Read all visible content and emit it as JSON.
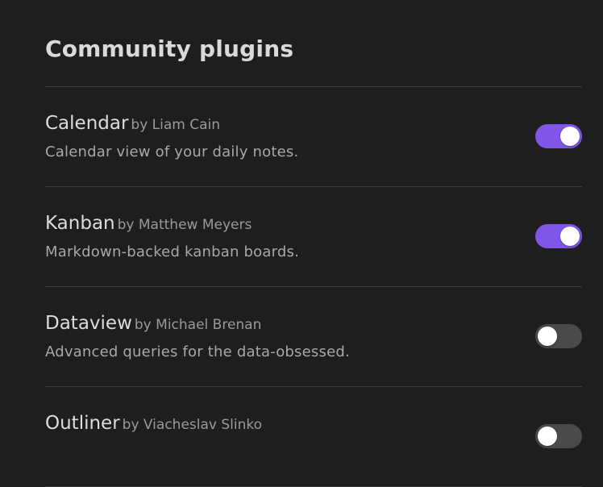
{
  "header": {
    "title": "Community plugins"
  },
  "colors": {
    "background": "#1e1e1e",
    "accent_toggle_on": "#7f57e8",
    "toggle_off": "#4a4a4a",
    "divider": "#3a3a3a"
  },
  "plugins": [
    {
      "name": "Calendar",
      "author": "by Liam Cain",
      "description": "Calendar view of your daily notes.",
      "enabled": true
    },
    {
      "name": "Kanban",
      "author": "by Matthew Meyers",
      "description": "Markdown-backed kanban boards.",
      "enabled": true
    },
    {
      "name": "Dataview",
      "author": "by Michael Brenan",
      "description": "Advanced queries for the data-obsessed.",
      "enabled": false
    },
    {
      "name": "Outliner",
      "author": "by Viacheslav Slinko",
      "description": "",
      "enabled": false
    }
  ]
}
